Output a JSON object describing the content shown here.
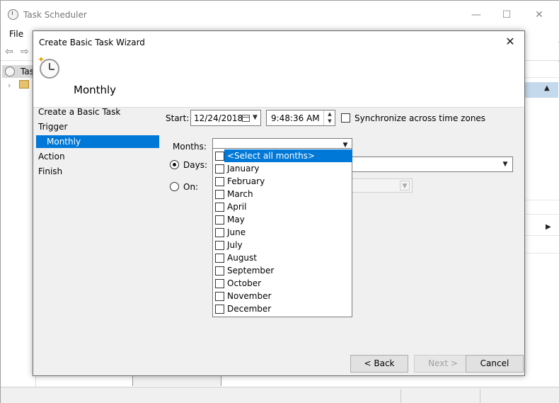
{
  "background_window": {
    "title": "Task Scheduler",
    "menu_file": "File",
    "tree_item": "Tas",
    "min_glyph": "—",
    "max_glyph": "☐",
    "close_glyph": "✕",
    "back_glyph": "⇦",
    "forward_glyph": "⇨",
    "tree_chevron": "›",
    "right_caret": "▲",
    "right_triangle": "▶"
  },
  "dialog": {
    "title": "Create Basic Task Wizard",
    "close_glyph": "✕",
    "header_title": "Monthly",
    "nav": {
      "create": "Create a Basic Task",
      "trigger": "Trigger",
      "monthly": "Monthly",
      "action": "Action",
      "finish": "Finish"
    },
    "form": {
      "start_label": "Start:",
      "start_date": "12/24/2018",
      "start_time": "9:48:36 AM",
      "sync_label": "Synchronize across time zones",
      "months_label": "Months:",
      "days_label": "Days:",
      "on_label": "On:",
      "drop_glyph": "▼",
      "spin_up": "▲",
      "spin_down": "▼"
    },
    "month_options": [
      "<Select all months>",
      "January",
      "February",
      "March",
      "April",
      "May",
      "June",
      "July",
      "August",
      "September",
      "October",
      "November",
      "December"
    ],
    "buttons": {
      "back": "< Back",
      "next": "Next >",
      "cancel": "Cancel"
    }
  },
  "colors": {
    "selection": "#0078d7",
    "dialog_bg": "#f0f0f0"
  }
}
